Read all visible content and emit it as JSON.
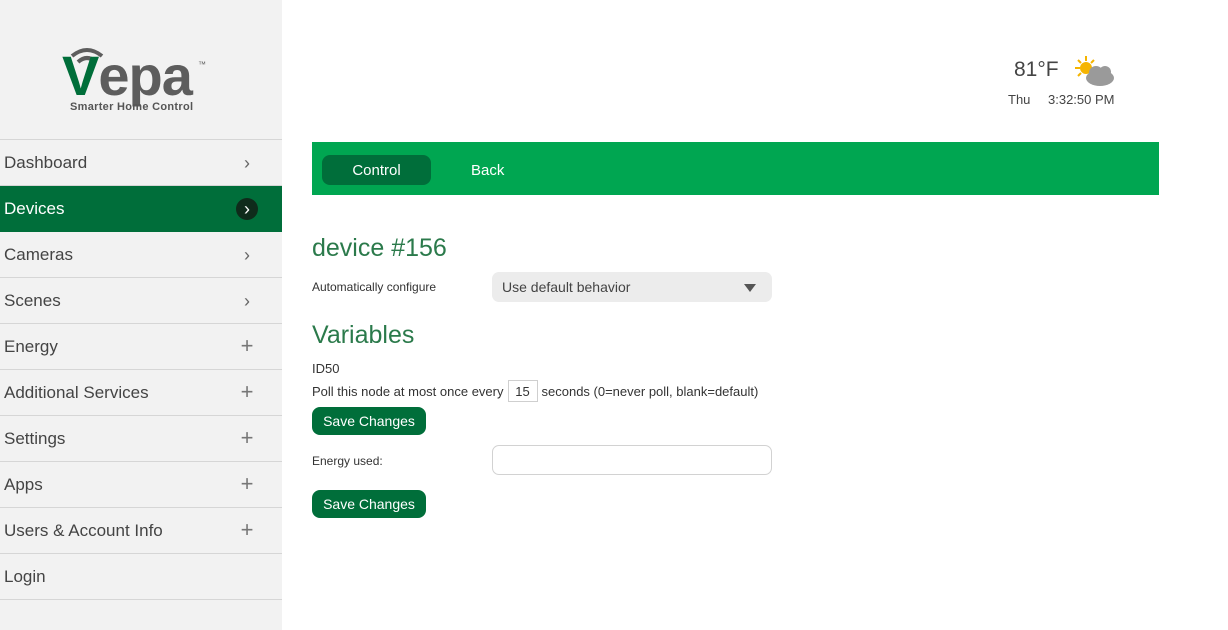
{
  "logo": {
    "word": "ера",
    "v": "V",
    "tm": "™",
    "tagline": "Smarter Home Control"
  },
  "sidebar": {
    "items": [
      {
        "label": "Dashboard",
        "control": "chevron"
      },
      {
        "label": "Devices",
        "control": "chevron",
        "active": true
      },
      {
        "label": "Cameras",
        "control": "chevron"
      },
      {
        "label": "Scenes",
        "control": "chevron"
      },
      {
        "label": "Energy",
        "control": "plus"
      },
      {
        "label": "Additional Services",
        "control": "plus"
      },
      {
        "label": "Settings",
        "control": "plus"
      },
      {
        "label": "Apps",
        "control": "plus"
      },
      {
        "label": "Users & Account Info",
        "control": "plus"
      },
      {
        "label": "Login",
        "control": "none"
      }
    ],
    "chevron_glyph": "›",
    "plus_glyph": "+"
  },
  "weather": {
    "temperature": "81°F",
    "day": "Thu",
    "time": "3:32:50 PM",
    "icon": "partly-cloudy-icon"
  },
  "toolbar": {
    "control_label": "Control",
    "back_label": "Back"
  },
  "device": {
    "title": "device #156",
    "auto_configure_label": "Automatically configure",
    "auto_configure_value": "Use default behavior"
  },
  "variables": {
    "title": "Variables",
    "id_label": "ID50",
    "poll_prefix": "Poll this node at most once every",
    "poll_value": "15",
    "poll_suffix": "seconds (0=never poll, blank=default)",
    "save_label": "Save Changes",
    "energy_label": "Energy used:",
    "energy_value": ""
  },
  "colors": {
    "brand_green": "#006e3a",
    "bar_green": "#00a651",
    "title_green": "#2b7a4b"
  }
}
